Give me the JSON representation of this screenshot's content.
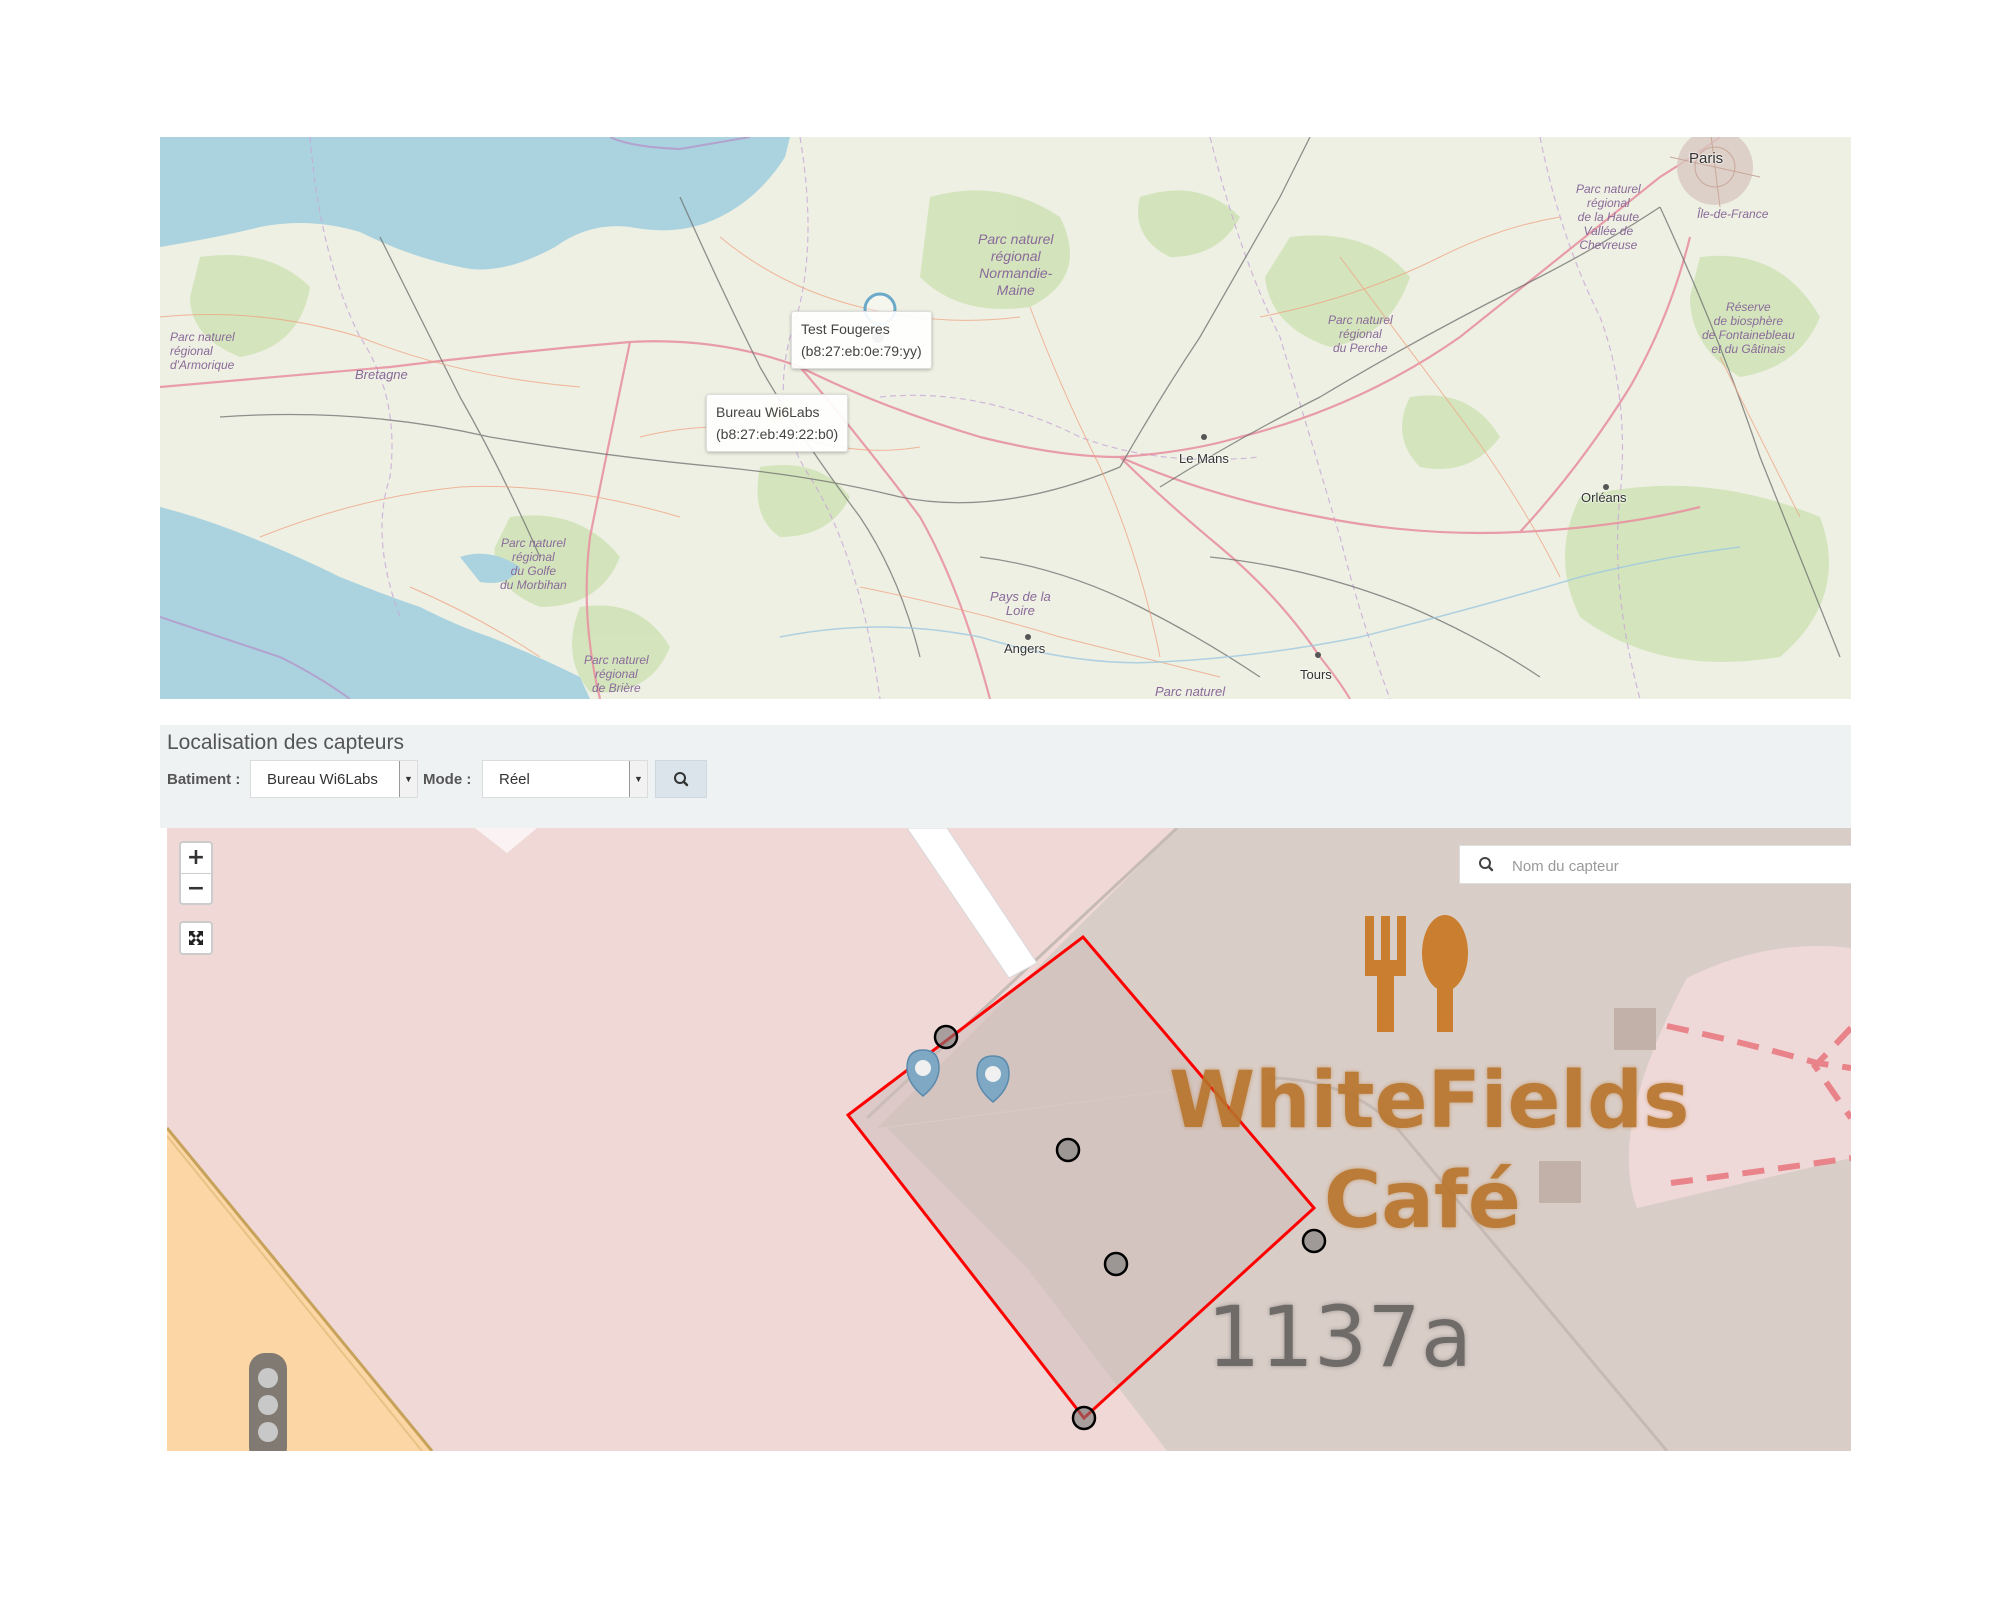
{
  "region_map": {
    "regions": [
      {
        "name": "parc-armorique",
        "text": "Parc naturel\nrégional\nd'Armorique"
      },
      {
        "name": "bretagne",
        "text": "Bretagne"
      },
      {
        "name": "parc-normandie-maine",
        "text": "Parc naturel\nrégional\nNormandie-\nMaine"
      },
      {
        "name": "parc-perche",
        "text": "Parc naturel\nrégional\ndu Perche"
      },
      {
        "name": "parc-haute-vallee",
        "text": "Parc naturel\nrégional\nde la Haute\nVallée de\nChevreuse"
      },
      {
        "name": "reserve-fontainebleau",
        "text": "Réserve\nde biosphère\nde Fontainebleau\net du Gâtinais"
      },
      {
        "name": "parc-golfe-morbihan",
        "text": "Parc naturel\nrégional\ndu Golfe\ndu Morbihan"
      },
      {
        "name": "pays-de-la-loire",
        "text": "Pays de la\nLoire"
      },
      {
        "name": "parc-briere",
        "text": "Parc naturel\nrégional\nde Brière"
      },
      {
        "name": "ile-de-france",
        "text": "Île-de-France"
      },
      {
        "name": "parc-naturel-bottom",
        "text": "Parc naturel"
      }
    ],
    "cities": [
      {
        "name": "paris",
        "text": "Paris"
      },
      {
        "name": "le-mans",
        "text": "Le Mans"
      },
      {
        "name": "orleans",
        "text": "Orléans"
      },
      {
        "name": "angers",
        "text": "Angers"
      },
      {
        "name": "tours",
        "text": "Tours"
      }
    ],
    "tooltips": [
      {
        "title": "Test Fougeres",
        "mac": "(b8:27:eb:0e:79:yy)"
      },
      {
        "title": "Bureau Wi6Labs",
        "mac": "(b8:27:eb:49:22:b0)"
      }
    ]
  },
  "panel": {
    "title": "Localisation des capteurs",
    "batiment_label": "Batiment :",
    "batiment_value": "Bureau Wi6Labs",
    "mode_label": "Mode :",
    "mode_value": "Réel"
  },
  "building_map": {
    "zoom_in": "+",
    "zoom_out": "−",
    "search_placeholder": "Nom du capteur",
    "poi_name_line1": "WhiteFields",
    "poi_name_line2": "Café",
    "address": "1137a",
    "polygon_color": "#ff0000",
    "poi_color": "#b8742a"
  },
  "icons": [
    "search-icon",
    "fullscreen-icon",
    "restaurant-icon",
    "map-marker-icon",
    "traffic-light-icon"
  ]
}
